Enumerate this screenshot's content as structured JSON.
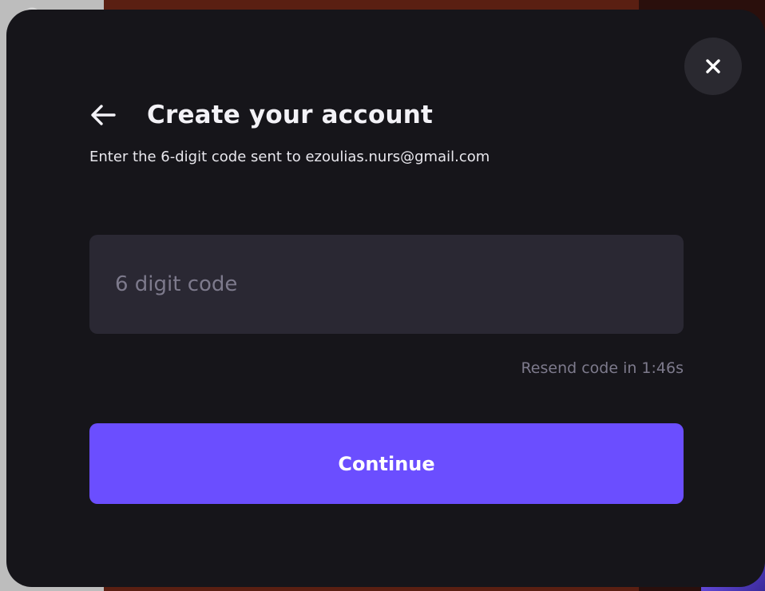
{
  "modal": {
    "close_icon": "close-icon",
    "back_icon": "arrow-left-icon",
    "title": "Create your account",
    "subtitle": "Enter the 6-digit code sent to ezoulias.nurs@gmail.com",
    "code_input": {
      "value": "",
      "placeholder": "6 digit code"
    },
    "resend_text": "Resend code in 1:46s",
    "continue_label": "Continue"
  },
  "colors": {
    "modal_bg": "#16151a",
    "input_bg": "#2a2833",
    "accent": "#6b4eff",
    "muted_text": "#7d7a8c",
    "close_button_bg": "#2a2930"
  }
}
